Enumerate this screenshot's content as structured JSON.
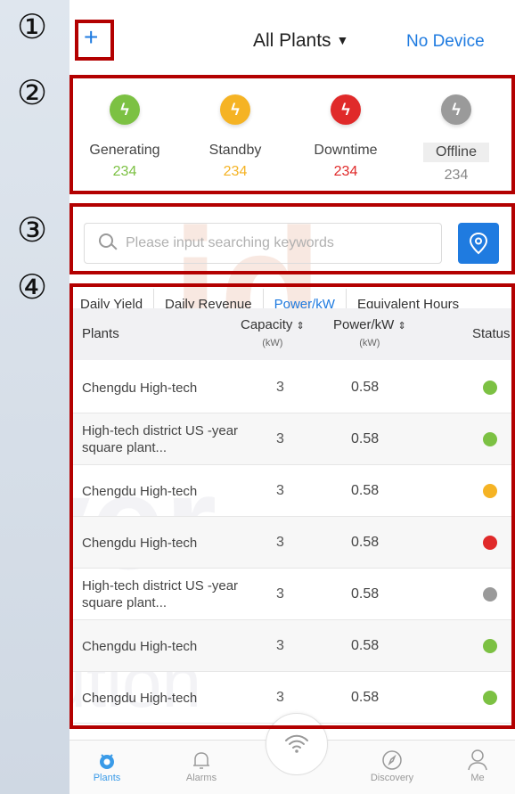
{
  "annotations": [
    "①",
    "②",
    "③",
    "④"
  ],
  "header": {
    "add_label": "+",
    "plant_selector": "All Plants",
    "device_status": "No Device"
  },
  "status_summary": [
    {
      "label": "Generating",
      "count": "234",
      "color": "#7cc143"
    },
    {
      "label": "Standby",
      "count": "234",
      "color": "#f5b324"
    },
    {
      "label": "Downtime",
      "count": "234",
      "color": "#e02a2a"
    },
    {
      "label": "Offline",
      "count": "234",
      "color": "#9a9a9a"
    }
  ],
  "search": {
    "placeholder": "Please input searching keywords",
    "locate_icon": "location-pin-icon"
  },
  "tabs": [
    {
      "label": "Daily Yield",
      "active": false
    },
    {
      "label": "Daily Revenue",
      "active": false
    },
    {
      "label": "Power/kW",
      "active": true
    },
    {
      "label": "Equivalent Hours",
      "active": false
    }
  ],
  "table": {
    "headers": {
      "plants": "Plants",
      "capacity": "Capacity",
      "capacity_unit": "(kW)",
      "power": "Power/kW",
      "power_unit": "(kW)",
      "status": "Status"
    },
    "rows": [
      {
        "name": "Chengdu High-tech",
        "capacity": "3",
        "power": "0.58",
        "status_color": "#7cc143"
      },
      {
        "name": "High-tech district US -year square plant...",
        "capacity": "3",
        "power": "0.58",
        "status_color": "#7cc143"
      },
      {
        "name": "Chengdu High-tech",
        "capacity": "3",
        "power": "0.58",
        "status_color": "#f5b324"
      },
      {
        "name": "Chengdu High-tech",
        "capacity": "3",
        "power": "0.58",
        "status_color": "#e02a2a"
      },
      {
        "name": "High-tech district US -year square plant...",
        "capacity": "3",
        "power": "0.58",
        "status_color": "#9a9a9a"
      },
      {
        "name": "Chengdu High-tech",
        "capacity": "3",
        "power": "0.58",
        "status_color": "#7cc143"
      },
      {
        "name": "Chengdu High-tech",
        "capacity": "3",
        "power": "0.58",
        "status_color": "#7cc143"
      }
    ]
  },
  "bottom_nav": [
    {
      "label": "Plants",
      "icon": "plants-icon",
      "active": true
    },
    {
      "label": "Alarms",
      "icon": "bell-icon",
      "active": false
    },
    {
      "label": "",
      "icon": "wifi-icon",
      "active": false
    },
    {
      "label": "Discovery",
      "icon": "compass-icon",
      "active": false
    },
    {
      "label": "Me",
      "icon": "user-icon",
      "active": false
    }
  ],
  "colors": {
    "accent": "#1f7be0",
    "annotation_box": "#b30000"
  }
}
